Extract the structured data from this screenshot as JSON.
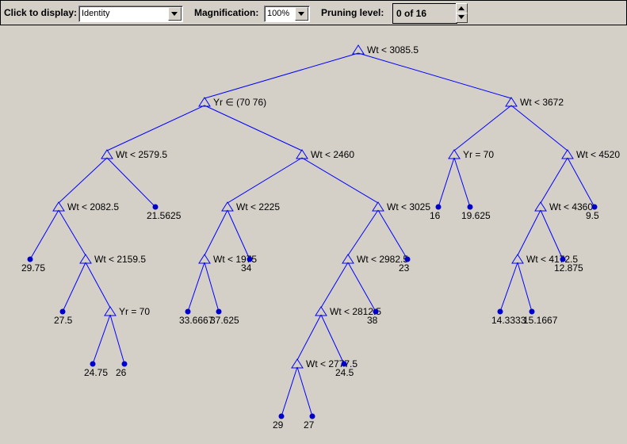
{
  "toolbar": {
    "display_label": "Click to display:",
    "display_value": "Identity",
    "magnification_label": "Magnification:",
    "magnification_value": "100%",
    "pruning_label": "Pruning level:",
    "pruning_value": "0 of 16"
  },
  "colors": {
    "edge": "#0000ff",
    "leaf": "#0000cc",
    "background": "#d4d0c8"
  },
  "tree": {
    "nodes": [
      {
        "id": "n1",
        "label": "Wt < 3085.5",
        "leaf": false
      },
      {
        "id": "n2",
        "label": "Yr ∈ (70  76)",
        "leaf": false,
        "parent": "n1"
      },
      {
        "id": "n3",
        "label": "Wt < 3672",
        "leaf": false,
        "parent": "n1"
      },
      {
        "id": "n4",
        "label": "Wt < 2579.5",
        "leaf": false,
        "parent": "n2"
      },
      {
        "id": "n5",
        "label": "Wt < 2460",
        "leaf": false,
        "parent": "n2"
      },
      {
        "id": "n6",
        "label": "Yr = 70",
        "leaf": false,
        "parent": "n3"
      },
      {
        "id": "n7",
        "label": "Wt < 4520",
        "leaf": false,
        "parent": "n3"
      },
      {
        "id": "n8",
        "label": "Wt < 2082.5",
        "leaf": false,
        "parent": "n4"
      },
      {
        "id": "n9",
        "label": "21.5625",
        "leaf": true,
        "parent": "n4"
      },
      {
        "id": "n10",
        "label": "Wt < 2225",
        "leaf": false,
        "parent": "n5"
      },
      {
        "id": "n11",
        "label": "Wt < 3025",
        "leaf": false,
        "parent": "n5"
      },
      {
        "id": "n12",
        "label": "16",
        "leaf": true,
        "parent": "n6"
      },
      {
        "id": "n13",
        "label": "19.625",
        "leaf": true,
        "parent": "n6"
      },
      {
        "id": "n14",
        "label": "Wt < 4360",
        "leaf": false,
        "parent": "n7"
      },
      {
        "id": "n15",
        "label": "9.5",
        "leaf": true,
        "parent": "n7"
      },
      {
        "id": "n16",
        "label": "29.75",
        "leaf": true,
        "parent": "n8"
      },
      {
        "id": "n17",
        "label": "Wt < 2159.5",
        "leaf": false,
        "parent": "n8"
      },
      {
        "id": "n18",
        "label": "Wt < 1975",
        "leaf": false,
        "parent": "n10"
      },
      {
        "id": "n19",
        "label": "34",
        "leaf": true,
        "parent": "n10"
      },
      {
        "id": "n20",
        "label": "Wt < 2982.5",
        "leaf": false,
        "parent": "n11"
      },
      {
        "id": "n21",
        "label": "23",
        "leaf": true,
        "parent": "n11"
      },
      {
        "id": "n22",
        "label": "Wt < 4172.5",
        "leaf": false,
        "parent": "n14"
      },
      {
        "id": "n23",
        "label": "12.875",
        "leaf": true,
        "parent": "n14"
      },
      {
        "id": "n24",
        "label": "27.5",
        "leaf": true,
        "parent": "n17"
      },
      {
        "id": "n25",
        "label": "Yr = 70",
        "leaf": false,
        "parent": "n17"
      },
      {
        "id": "n26",
        "label": "33.6667",
        "leaf": true,
        "parent": "n18"
      },
      {
        "id": "n27",
        "label": "37.625",
        "leaf": true,
        "parent": "n18"
      },
      {
        "id": "n28",
        "label": "Wt < 2812.5",
        "leaf": false,
        "parent": "n20"
      },
      {
        "id": "n29",
        "label": "38",
        "leaf": true,
        "parent": "n20"
      },
      {
        "id": "n30",
        "label": "14.3333",
        "leaf": true,
        "parent": "n22"
      },
      {
        "id": "n31",
        "label": "15.1667",
        "leaf": true,
        "parent": "n22"
      },
      {
        "id": "n32",
        "label": "24.75",
        "leaf": true,
        "parent": "n25"
      },
      {
        "id": "n33",
        "label": "26",
        "leaf": true,
        "parent": "n25"
      },
      {
        "id": "n34",
        "label": "Wt < 2777.5",
        "leaf": false,
        "parent": "n28"
      },
      {
        "id": "n35",
        "label": "24.5",
        "leaf": true,
        "parent": "n28"
      },
      {
        "id": "n36",
        "label": "29",
        "leaf": true,
        "parent": "n34"
      },
      {
        "id": "n37",
        "label": "27",
        "leaf": true,
        "parent": "n34"
      }
    ]
  }
}
